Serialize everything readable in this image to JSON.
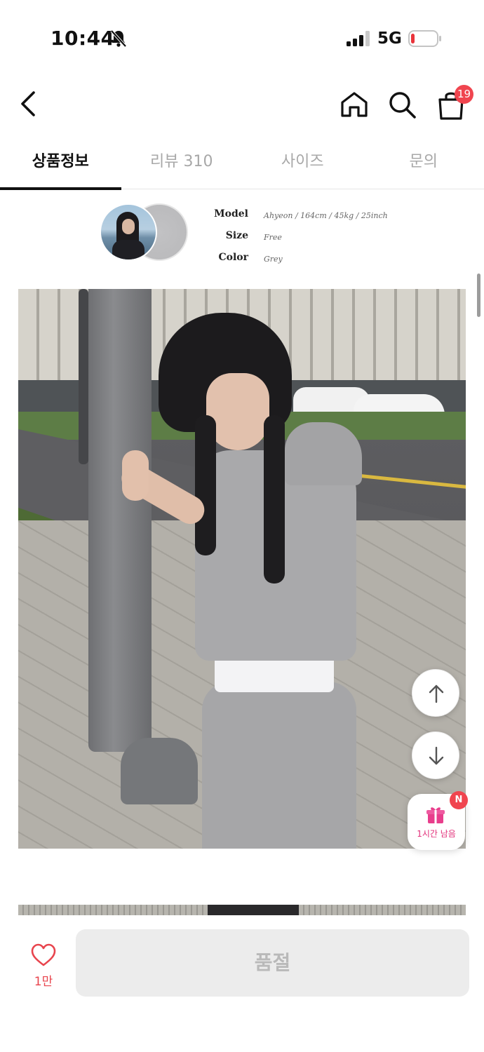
{
  "status_bar": {
    "time": "10:44",
    "network": "5G",
    "icons": [
      "bell-slash-icon",
      "signal-icon",
      "battery-low-icon"
    ]
  },
  "nav": {
    "icons": [
      "back-icon",
      "home-icon",
      "search-icon",
      "cart-icon"
    ],
    "cart_count": "19"
  },
  "tabs": [
    {
      "label": "상품정보",
      "active": true
    },
    {
      "label": "리뷰 310",
      "active": false
    },
    {
      "label": "사이즈",
      "active": false
    },
    {
      "label": "문의",
      "active": false
    }
  ],
  "model_info": {
    "labels": {
      "model": "Model",
      "size": "Size",
      "color": "Color"
    },
    "values": {
      "model": "Ahyeon / 164cm / 45kg / 25inch",
      "size": "Free",
      "color": "Grey"
    }
  },
  "floating": {
    "icons": [
      "arrow-up-icon",
      "arrow-down-icon",
      "gift-icon"
    ],
    "coupon_label": "1시간 남음",
    "coupon_badge": "N"
  },
  "bottom_bar": {
    "wish_count": "1만",
    "main_button_label": "품절",
    "accent_color": "#e8444d"
  }
}
